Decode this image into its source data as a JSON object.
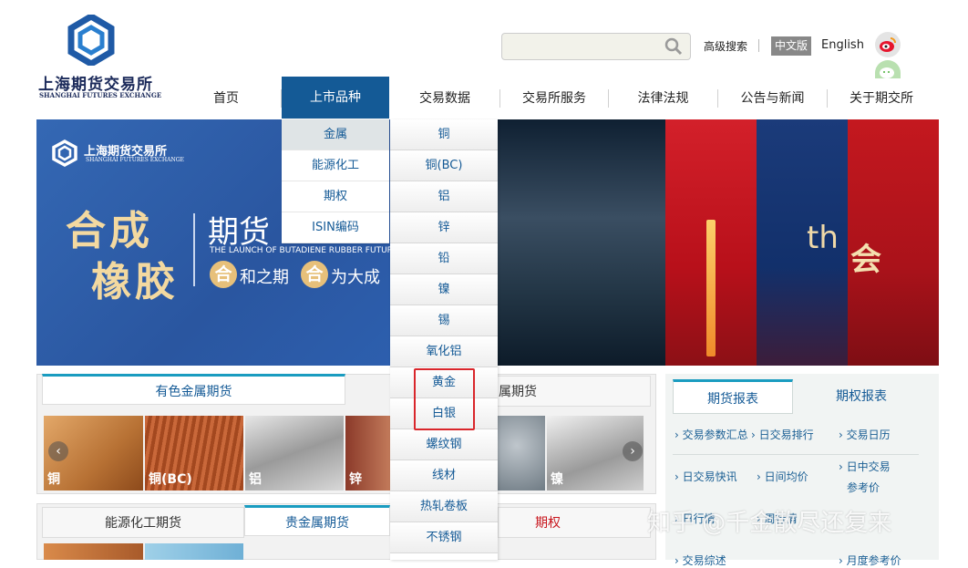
{
  "header": {
    "logo_cn": "上海期货交易所",
    "logo_en": "SHANGHAI FUTURES EXCHANGE",
    "search_placeholder": "",
    "advanced_search": "高级搜索",
    "lang_cn": "中文版",
    "lang_en": "English",
    "icons": [
      "logo-hexagon-icon",
      "search-icon",
      "weibo-icon",
      "wechat-icon"
    ]
  },
  "nav": {
    "items": [
      {
        "label": "首页"
      },
      {
        "label": "上市品种",
        "active": true
      },
      {
        "label": "交易数据"
      },
      {
        "label": "交易所服务"
      },
      {
        "label": "法律法规"
      },
      {
        "label": "公告与新闻"
      },
      {
        "label": "关于期交所"
      }
    ]
  },
  "dropdown_categories": [
    "金属",
    "能源化工",
    "期权",
    "ISIN编码"
  ],
  "dropdown_products": [
    "铜",
    "铜(BC)",
    "铝",
    "锌",
    "铅",
    "镍",
    "锡",
    "氧化铝",
    "黄金",
    "白银",
    "螺纹钢",
    "线材",
    "热轧卷板",
    "不锈钢"
  ],
  "highlighted_products": [
    "黄金",
    "白银"
  ],
  "banner": {
    "logo_cn": "上海期货交易所",
    "logo_en": "SHANGHAI FUTURES EXCHANGE",
    "char_line1": "合成",
    "char_line2": "橡胶",
    "title": "期货",
    "subtitle_en": "THE LAUNCH OF BUTADIENE RUBBER FUTURES",
    "slogan_1_badge": "合",
    "slogan_1_text": "和之期",
    "slogan_2_badge": "合",
    "slogan_2_text": "为大成",
    "th_text": "th",
    "hui_text": "会"
  },
  "sections": {
    "metals_tab_1": "有色金属期货",
    "metals_tab_2": "属期货",
    "metals_thumbs": [
      "铜",
      "铜(BC)",
      "铝",
      "锌",
      "镍"
    ],
    "energy_tab": "能源化工期货",
    "precious_tab": "贵金属期货",
    "options_tab": "期权"
  },
  "reports": {
    "tab_futures": "期货报表",
    "tab_options": "期权报表",
    "links": [
      "交易参数汇总",
      "日交易排行",
      "交易日历",
      "日交易快讯",
      "日间均价",
      "日中交易",
      "参考价",
      "日行情",
      "周行情",
      "月度参考价",
      "交易综述"
    ]
  },
  "watermark": "知乎 @千金散尽还复来",
  "colors": {
    "nav_active": "#145a96",
    "highlight_border": "#d9262b",
    "link": "#1b5f94"
  }
}
